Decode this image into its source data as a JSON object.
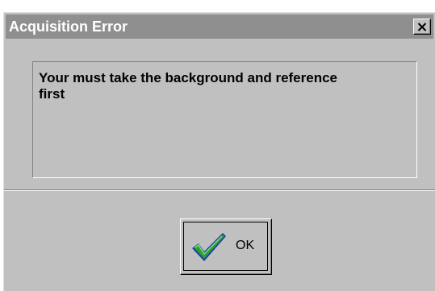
{
  "dialog": {
    "title": "Acquisition Error",
    "message": "Your must take the background and reference first",
    "close_icon": "close-icon",
    "ok_button": {
      "label": "OK",
      "icon": "checkmark-icon"
    }
  },
  "colors": {
    "face": "#c0c0c0",
    "titlebar": "#8f8f8f",
    "title_text": "#ffffff",
    "check_green": "#2e9e2e",
    "check_blue": "#1d3fa8"
  }
}
